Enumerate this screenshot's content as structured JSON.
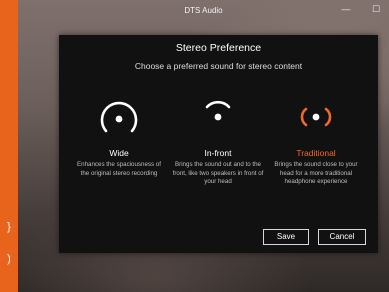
{
  "window": {
    "title": "DTS Audio",
    "minimize_glyph": "—",
    "maximize_glyph": "☐"
  },
  "sidebar": {
    "color": "#e8641c",
    "icons": [
      {
        "name": "code-brace-icon",
        "glyph": "}"
      },
      {
        "name": "power-icon",
        "glyph": ")"
      }
    ]
  },
  "dialog": {
    "title": "Stereo Preference",
    "subtitle": "Choose a preferred sound for stereo content",
    "selected_option": "traditional",
    "accent_color": "#ef6a2a",
    "options": [
      {
        "id": "wide",
        "icon": "wide-soundstage-icon",
        "label": "Wide",
        "description": "Enhances the spaciousness of the original stereo recording"
      },
      {
        "id": "in-front",
        "icon": "in-front-soundstage-icon",
        "label": "In-front",
        "description": "Brings the sound out and to the front, like two speakers in front of your head"
      },
      {
        "id": "traditional",
        "icon": "traditional-soundstage-icon",
        "label": "Traditional",
        "description": "Brings the sound close to your head for a more traditional headphone experience"
      }
    ],
    "save_label": "Save",
    "cancel_label": "Cancel"
  }
}
